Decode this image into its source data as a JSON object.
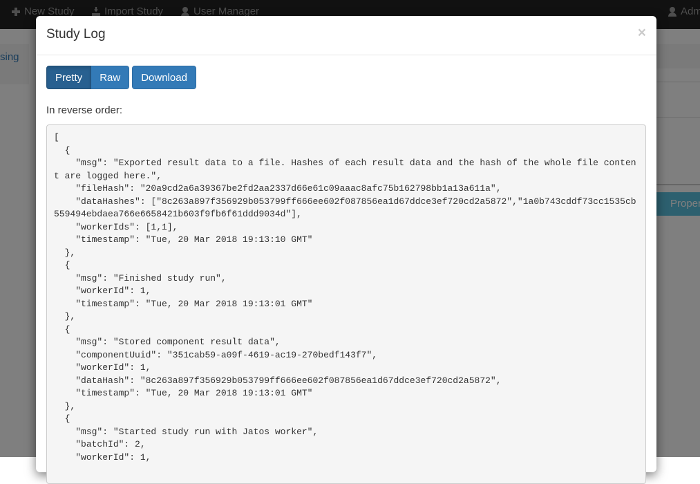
{
  "navbar": {
    "items": [
      {
        "label": "New Study",
        "icon": "plus-icon"
      },
      {
        "label": "Import Study",
        "icon": "import-icon"
      },
      {
        "label": "User Manager",
        "icon": "user-icon"
      }
    ],
    "user": {
      "label": "Adm",
      "icon": "user-icon"
    }
  },
  "background": {
    "sidebar_link": "sing",
    "properties_button": "Proper"
  },
  "modal": {
    "title": "Study Log",
    "close_label": "×",
    "view_buttons": [
      {
        "label": "Pretty",
        "active": true
      },
      {
        "label": "Raw",
        "active": false
      }
    ],
    "download_label": "Download",
    "order_label": "In reverse order:",
    "log_lines": [
      "[",
      "  {",
      "    \"msg\": \"Exported result data to a file. Hashes of each result data and the hash of the whole file content are logged here.\",",
      "    \"fileHash\": \"20a9cd2a6a39367be2fd2aa2337d66e61c09aaac8afc75b162798bb1a13a611a\",",
      "    \"dataHashes\": [\"8c263a897f356929b053799ff666ee602f087856ea1d67ddce3ef720cd2a5872\",\"1a0b743cddf73cc1535cb559494ebdaea766e6658421b603f9fb6f61ddd9034d\"],",
      "    \"workerIds\": [1,1],",
      "    \"timestamp\": \"Tue, 20 Mar 2018 19:13:10 GMT\"",
      "  },",
      "  {",
      "    \"msg\": \"Finished study run\",",
      "    \"workerId\": 1,",
      "    \"timestamp\": \"Tue, 20 Mar 2018 19:13:01 GMT\"",
      "  },",
      "  {",
      "    \"msg\": \"Stored component result data\",",
      "    \"componentUuid\": \"351cab59-a09f-4619-ac19-270bedf143f7\",",
      "    \"workerId\": 1,",
      "    \"dataHash\": \"8c263a897f356929b053799ff666ee602f087856ea1d67ddce3ef720cd2a5872\",",
      "    \"timestamp\": \"Tue, 20 Mar 2018 19:13:01 GMT\"",
      "  },",
      "  {",
      "    \"msg\": \"Started study run with Jatos worker\",",
      "    \"batchId\": 2,",
      "    \"workerId\": 1,"
    ]
  }
}
